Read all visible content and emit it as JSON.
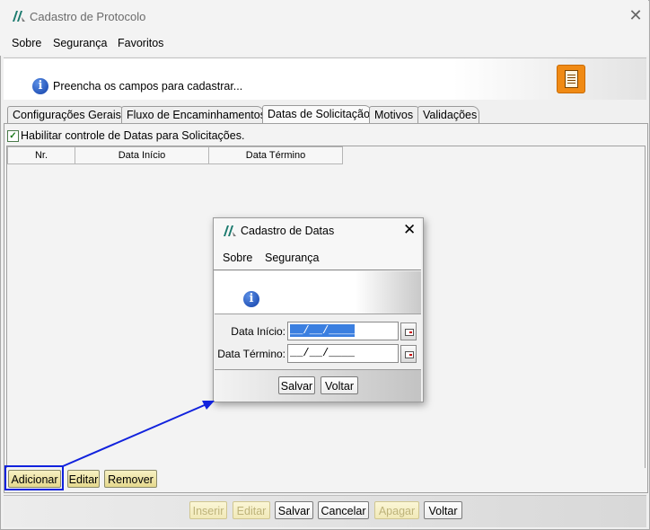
{
  "window": {
    "title": "Cadastro de Protocolo"
  },
  "menu": [
    "Sobre",
    "Segurança",
    "Favoritos"
  ],
  "header": {
    "message": "Preencha os campos para cadastrar..."
  },
  "tabs": [
    "Configurações Gerais",
    "Fluxo de Encaminhamentos",
    "Datas de Solicitação",
    "Motivos",
    "Validações"
  ],
  "active_tab": "Datas de Solicitação",
  "checkbox": {
    "label": "Habilitar controle de Datas para Solicitações.",
    "checked": true
  },
  "table": {
    "columns": [
      "Nr.",
      "Data Início",
      "Data Término"
    ],
    "rows": []
  },
  "grid_buttons": [
    "Adicionar",
    "Editar",
    "Remover"
  ],
  "footer_buttons": [
    "Inserir",
    "Editar",
    "Salvar",
    "Cancelar",
    "Apagar",
    "Voltar"
  ],
  "dialog": {
    "title": "Cadastro de Datas",
    "menu": [
      "Sobre",
      "Segurança"
    ],
    "fields": [
      {
        "label": "Data Início:",
        "value": "__/__/____"
      },
      {
        "label": "Data Término:",
        "value": "__/__/____"
      }
    ],
    "buttons": [
      "Salvar",
      "Voltar"
    ]
  },
  "annotation_color": "#1122dd"
}
